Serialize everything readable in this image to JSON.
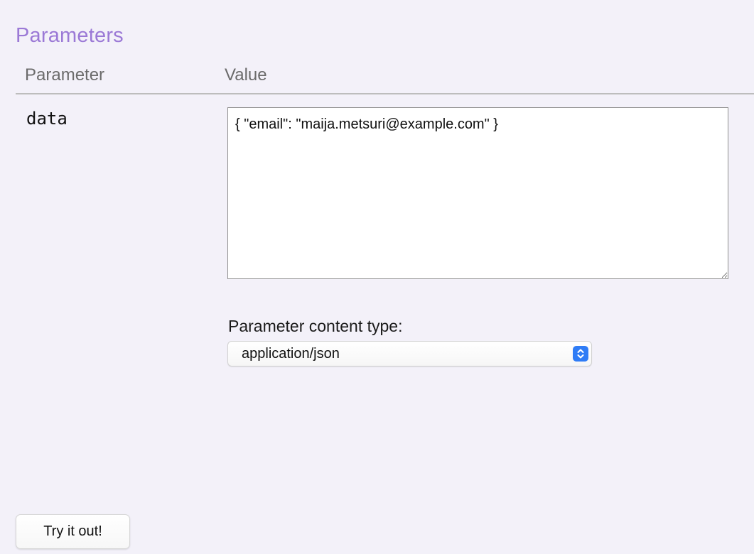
{
  "section": {
    "title": "Parameters"
  },
  "table": {
    "headers": {
      "parameter": "Parameter",
      "value": "Value"
    },
    "rows": [
      {
        "name": "data",
        "value": "{ \"email\": \"maija.metsuri@example.com\" }"
      }
    ]
  },
  "content_type": {
    "label": "Parameter content type:",
    "selected": "application/json"
  },
  "actions": {
    "try_label": "Try it out!"
  },
  "colors": {
    "title": "#9b79d6",
    "background": "#f3f1f9",
    "select_accent": "#2f7cf6"
  },
  "icons": {
    "select_arrows": "up-down-chevron-icon"
  }
}
